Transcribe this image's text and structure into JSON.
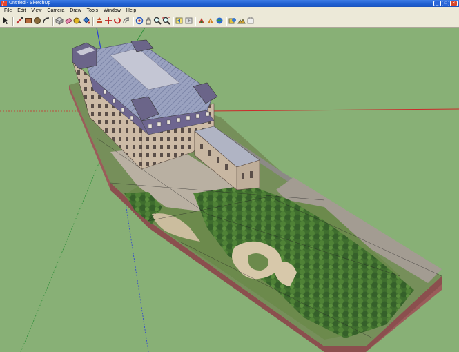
{
  "window": {
    "title": "Untitled - SketchUp"
  },
  "menu": {
    "items": [
      "File",
      "Edit",
      "View",
      "Camera",
      "Draw",
      "Tools",
      "Window",
      "Help"
    ]
  },
  "toolbar": {
    "tools": [
      "select-icon",
      "line-icon",
      "rectangle-icon",
      "circle-icon",
      "arc-icon",
      "make-component-icon",
      "eraser-icon",
      "tape-measure-icon",
      "paint-bucket-icon",
      "push-pull-icon",
      "move-icon",
      "rotate-icon",
      "offset-icon",
      "orbit-icon",
      "pan-icon",
      "zoom-icon",
      "zoom-extents-icon",
      "previous-view-icon",
      "next-view-icon",
      "get-models-icon",
      "share-model-icon",
      "google-earth-icon",
      "get-current-view-icon",
      "toggle-terrain-icon",
      "place-model-icon"
    ]
  },
  "colors": {
    "ground": "#88b076",
    "titlebar": "#2462d4",
    "chrome": "#ece9d8",
    "axis_red": "#cc2a2a",
    "axis_green": "#2f8f3a",
    "axis_blue": "#2b3fd6",
    "roof": "#8f96b8",
    "facade": "#c9b9a6",
    "tree": "#3d6b2d",
    "lawn": "#6f8a50",
    "path": "#d4c4a8",
    "base_wall": "#9b5c5a",
    "road": "#8c8a86"
  }
}
